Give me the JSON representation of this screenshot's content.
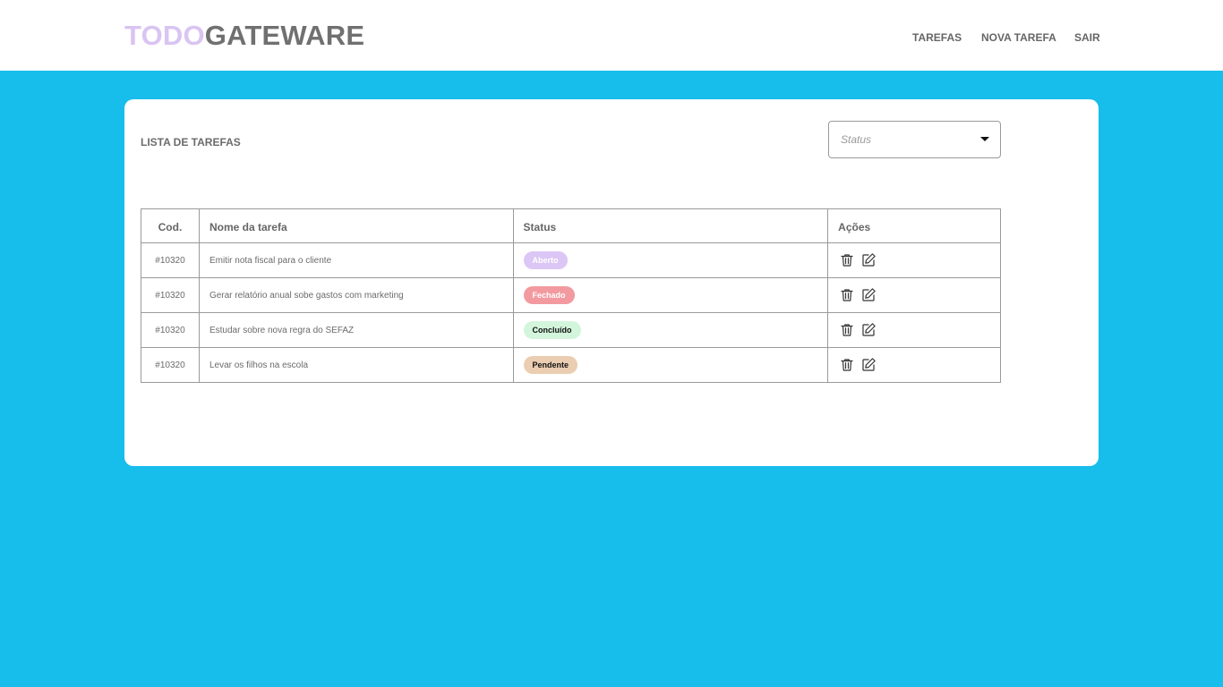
{
  "header": {
    "logo_part1": "TODO",
    "logo_part2": "GATEWARE",
    "nav": {
      "tarefas": "TAREFAS",
      "nova_tarefa": "NOVA TAREFA",
      "sair": "SAIR"
    }
  },
  "main": {
    "title": "LISTA DE TAREFAS",
    "filter": {
      "placeholder": "Status",
      "icon": "chevron-down-icon"
    },
    "table": {
      "columns": {
        "cod": "Cod.",
        "nome": "Nome da tarefa",
        "status": "Status",
        "acoes": "Ações"
      },
      "rows": [
        {
          "cod": "#10320",
          "nome": "Emitir nota fiscal para o cliente",
          "status": "Aberto",
          "status_bg": "#dcc6f5",
          "status_fg": "#ffffff"
        },
        {
          "cod": "#10320",
          "nome": "Gerar relatório anual sobe gastos com marketing",
          "status": "Fechado",
          "status_bg": "#f29a9f",
          "status_fg": "#ffffff"
        },
        {
          "cod": "#10320",
          "nome": "Estudar sobre nova regra do SEFAZ",
          "status": "Concluído",
          "status_bg": "#d3f5dc",
          "status_fg": "#111111"
        },
        {
          "cod": "#10320",
          "nome": "Levar os filhos na escola",
          "status": "Pendente",
          "status_bg": "#ebcdb1",
          "status_fg": "#111111"
        }
      ],
      "action_icons": [
        "trash-icon",
        "edit-icon"
      ]
    }
  },
  "colors": {
    "background": "#17bdeb",
    "logo_accent": "#d9c4f2",
    "logo_text": "#707070"
  }
}
